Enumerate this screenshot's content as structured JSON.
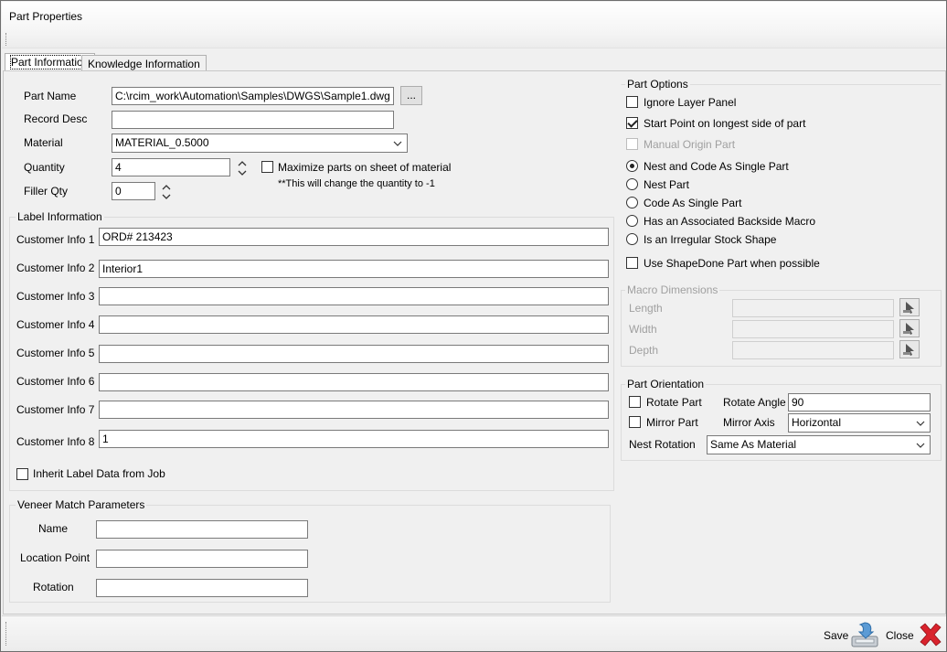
{
  "window": {
    "title": "Part Properties"
  },
  "tabs": [
    {
      "label": "Part Information",
      "active": true
    },
    {
      "label": "Knowledge Information",
      "active": false
    }
  ],
  "part": {
    "name_label": "Part Name",
    "name_value": "C:\\rcim_work\\Automation\\Samples\\DWGS\\Sample1.dwg",
    "browse_label": "...",
    "record_desc_label": "Record Desc",
    "record_desc_value": "",
    "material_label": "Material",
    "material_value": "MATERIAL_0.5000",
    "quantity_label": "Quantity",
    "quantity_value": "4",
    "maximize_label": "Maximize parts on sheet of material",
    "maximize_note": "**This will change the quantity to -1",
    "filler_label": "Filler Qty",
    "filler_value": "0"
  },
  "label_info": {
    "title": "Label Information",
    "fields": [
      {
        "label": "Customer Info 1",
        "value": "ORD# 213423"
      },
      {
        "label": "Customer Info 2",
        "value": "Interior1"
      },
      {
        "label": "Customer Info 3",
        "value": ""
      },
      {
        "label": "Customer Info 4",
        "value": ""
      },
      {
        "label": "Customer Info 5",
        "value": ""
      },
      {
        "label": "Customer Info 6",
        "value": ""
      },
      {
        "label": "Customer Info 7",
        "value": ""
      },
      {
        "label": "Customer Info 8",
        "value": "1"
      }
    ],
    "inherit_label": "Inherit Label Data from Job"
  },
  "veneer": {
    "title": "Veneer Match Parameters",
    "name_label": "Name",
    "name_value": "",
    "location_label": "Location Point",
    "location_value": "",
    "rotation_label": "Rotation",
    "rotation_value": ""
  },
  "part_options": {
    "title": "Part Options",
    "ignore_layer": "Ignore Layer Panel",
    "start_point": "Start Point on longest side of part",
    "manual_origin": "Manual Origin Part",
    "radios": [
      "Nest and Code As Single Part",
      "Nest Part",
      "Code As Single Part",
      "Has an Associated Backside Macro",
      "Is an Irregular Stock Shape"
    ],
    "shapedone": "Use ShapeDone Part when possible"
  },
  "macro": {
    "title": "Macro Dimensions",
    "length_label": "Length",
    "width_label": "Width",
    "depth_label": "Depth"
  },
  "orientation": {
    "title": "Part Orientation",
    "rotate_part": "Rotate Part",
    "rotate_angle_label": "Rotate Angle",
    "rotate_angle_value": "90",
    "mirror_part": "Mirror Part",
    "mirror_axis_label": "Mirror Axis",
    "mirror_axis_value": "Horizontal",
    "nest_rotation_label": "Nest Rotation",
    "nest_rotation_value": "Same As Material"
  },
  "footer": {
    "save_label": "Save",
    "close_label": "Close"
  }
}
